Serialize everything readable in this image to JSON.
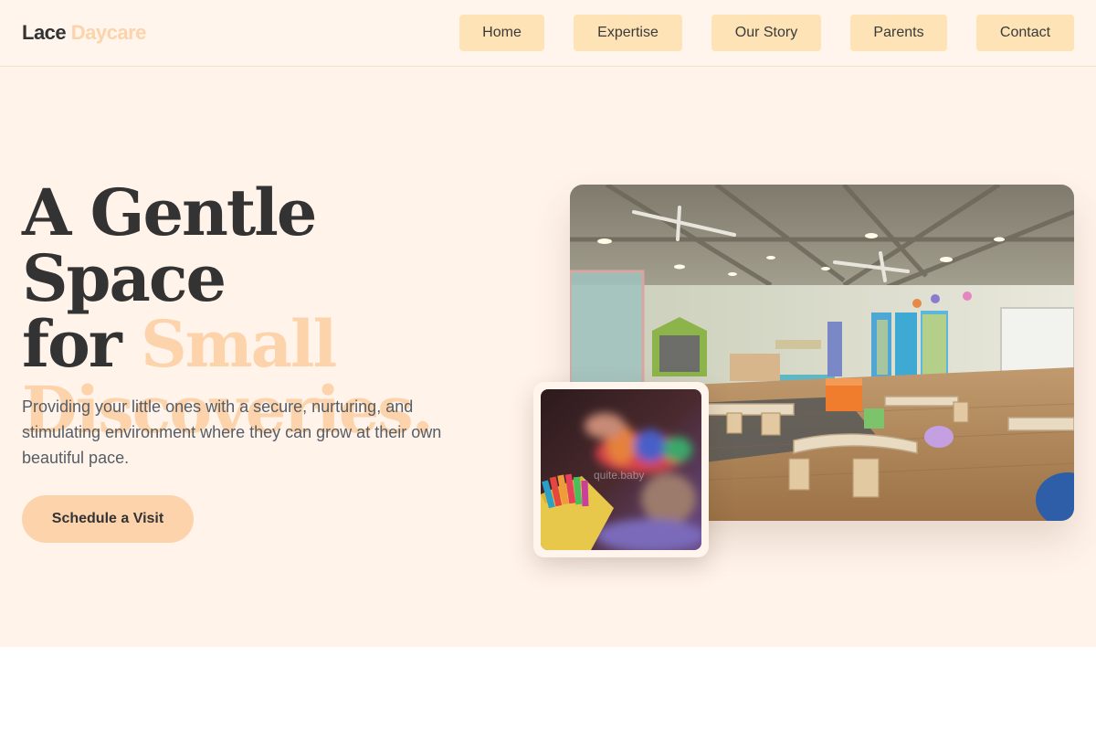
{
  "brand": {
    "name_part1": "Lace",
    "name_part2": "Daycare"
  },
  "nav": {
    "items": [
      {
        "label": "Home"
      },
      {
        "label": "Expertise"
      },
      {
        "label": "Our Story"
      },
      {
        "label": "Parents"
      },
      {
        "label": "Contact"
      }
    ]
  },
  "hero": {
    "headline_line1": "A Gentle Space",
    "headline_for": "for ",
    "headline_accent_1": "Small",
    "headline_accent_2": "Discoveries.",
    "description": "Providing your little ones with a secure, nurturing, and stimulating environment where they can grow at their own beautiful pace.",
    "cta_label": "Schedule a Visit"
  },
  "images": {
    "main_photo": "classroom-photo",
    "inset_photo": "crayons-photo",
    "watermark": "quite.baby"
  },
  "colors": {
    "accent_peach": "#fcd3aa",
    "nav_button": "#fde3b6",
    "background": "#fff3ea",
    "text_dark": "#333333"
  }
}
